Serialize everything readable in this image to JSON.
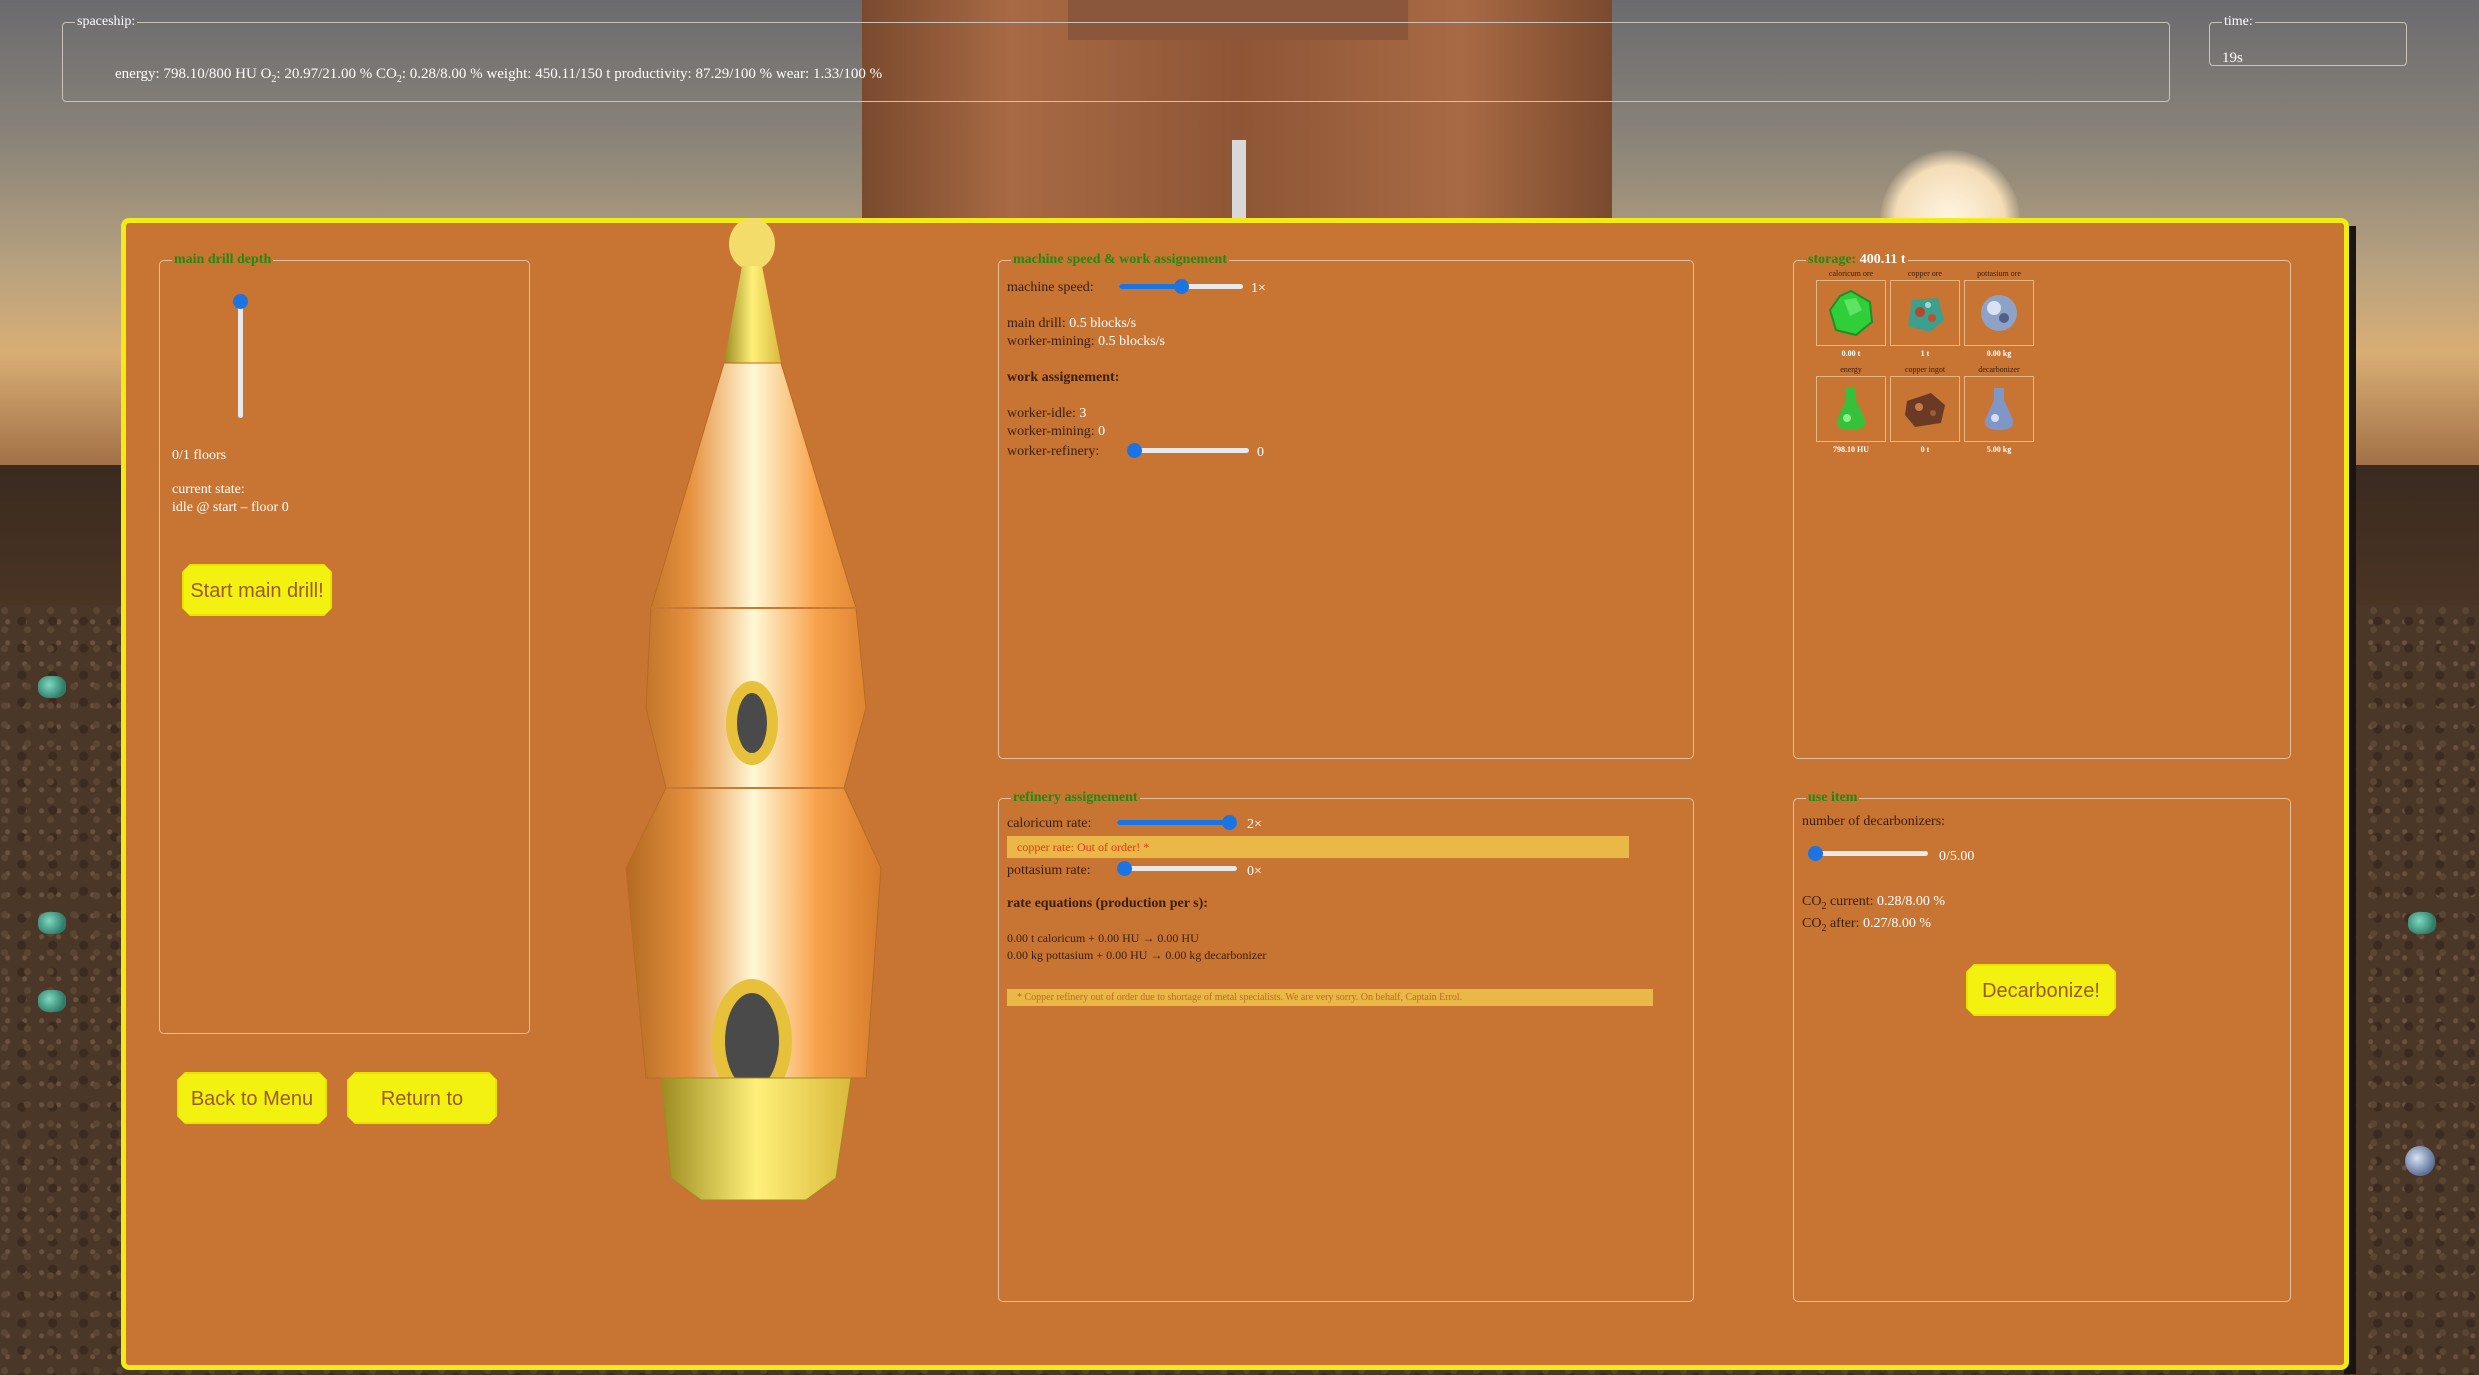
{
  "hud": {
    "ship_legend": "spaceship:",
    "energy_label": "energy:",
    "energy_value": "798.10/800 HU",
    "o2_label": "O",
    "o2_sub": "2",
    "o2_value": ": 20.97/21.00 %",
    "co2_label": "CO",
    "co2_sub": "2",
    "co2_value": ": 0.28/8.00 %",
    "weight_label": "weight:",
    "weight_value": "450.11/150 t",
    "productivity_label": "productivity:",
    "productivity_value": "87.29/100 %",
    "wear_label": "wear:",
    "wear_value": "1.33/100 %",
    "time_legend": "time:",
    "time_value": "19s"
  },
  "drill": {
    "legend": "main drill depth",
    "floors": "0/1 floors",
    "state_label": "current state:",
    "state_value": "idle @ start – floor 0",
    "depth_fraction": 0,
    "start_button": "Start main drill!"
  },
  "nav": {
    "back_menu": "Back to Menu",
    "return_game": "Return to Game"
  },
  "machine": {
    "legend": "machine speed & work assignement",
    "speed_label": "machine speed:",
    "speed_value": "1×",
    "speed_fraction": 0.5,
    "main_drill_label": "main drill:",
    "main_drill_value": "0.5 blocks/s",
    "worker_mining_rate_label": "worker-mining:",
    "worker_mining_rate_value": "0.5 blocks/s",
    "work_heading": "work assignement:",
    "worker_idle_label": "worker-idle:",
    "worker_idle_value": "3",
    "worker_mining_label": "worker-mining:",
    "worker_mining_value": "0",
    "worker_refinery_label": "worker-refinery:",
    "worker_refinery_value": "0",
    "worker_refinery_fraction": 0
  },
  "refinery": {
    "legend": "refinery assignement",
    "caloricum_label": "caloricum rate:",
    "caloricum_value": "2×",
    "caloricum_fraction": 1.0,
    "copper_warning": "copper rate: Out of order! *",
    "pottasium_label": "pottasium rate:",
    "pottasium_value": "0×",
    "pottasium_fraction": 0,
    "equations_heading": "rate equations (production per s):",
    "equation_1": "0.00 t caloricum + 0.00 HU → 0.00 HU",
    "equation_2": "0.00 kg pottasium + 0.00 HU → 0.00 kg decarbonizer",
    "note": "* Copper refinery out of order due to shortage of metal specialists. We are very sorry. On behalf, Captain Errol."
  },
  "storage": {
    "legend": "storage:",
    "total": "400.11 t",
    "items": [
      {
        "label": "caloricum ore",
        "value": "0.00 t",
        "icon": "caloricum-ore-icon",
        "color": "#2fcf3a"
      },
      {
        "label": "copper ore",
        "value": "1 t",
        "icon": "copper-ore-icon",
        "color": "#3d9f8e"
      },
      {
        "label": "pottasium ore",
        "value": "0.00 kg",
        "icon": "pottasium-ore-icon",
        "color": "#8ea2c8"
      },
      {
        "label": "energy",
        "value": "798.10 HU",
        "icon": "energy-flask-icon",
        "color": "#35c23a"
      },
      {
        "label": "copper ingot",
        "value": "0 t",
        "icon": "copper-ingot-icon",
        "color": "#6b3a24"
      },
      {
        "label": "decarbonizer",
        "value": "5.00 kg",
        "icon": "decarbonizer-flask-icon",
        "color": "#7f96c6"
      }
    ]
  },
  "use_item": {
    "legend": "use item",
    "count_label": "number of decarbonizers:",
    "count_value": "0/5.00",
    "count_fraction": 0,
    "co2_current_label": "current:",
    "co2_current_value": "0.28/8.00 %",
    "co2_after_label": "after:",
    "co2_after_value": "0.27/8.00 %",
    "co_label": "CO",
    "co_sub": "2",
    "button": "Decarbonize!"
  },
  "colors": {
    "panel": "#c87533",
    "panel_border": "#f2ec14",
    "heading_green": "#1d8b13",
    "slider_blue": "#1b74e4",
    "button_yellow": "#f2f10f"
  }
}
